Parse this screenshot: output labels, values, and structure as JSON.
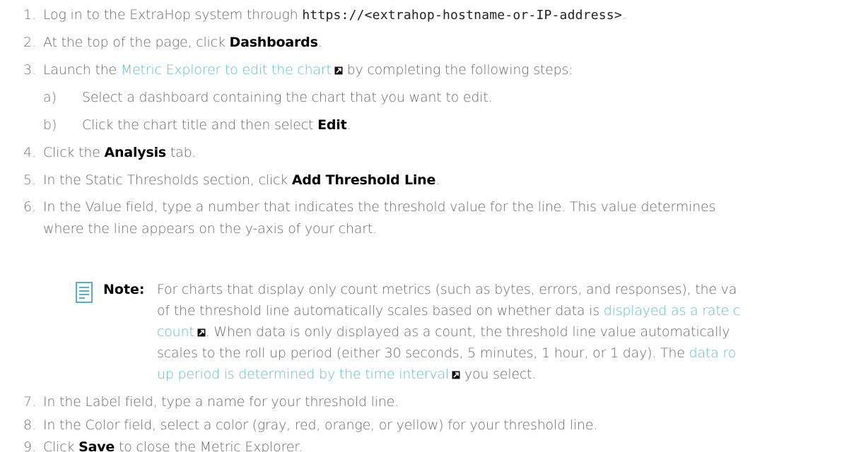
{
  "steps": [
    {
      "num": "1.",
      "text_a": "Log in to the ExtraHop system through ",
      "code": "https://<extrahop-hostname-or-IP-address>",
      "text_b": "."
    },
    {
      "num": "2.",
      "text_a": "At the top of the page, click ",
      "bold": "Dashboards",
      "text_b": "."
    },
    {
      "num": "3.",
      "text_a": "Launch the ",
      "link": "Metric Explorer to edit the chart",
      "text_b": " by completing the following steps:"
    },
    {
      "num": "4.",
      "text_a": "Click the ",
      "bold": "Analysis",
      "text_b": " tab."
    },
    {
      "num": "5.",
      "text_a": "In the Static Thresholds section, click ",
      "bold": "Add Threshold Line",
      "text_b": "."
    },
    {
      "num": "6.",
      "line1": "In the Value field, type a number that indicates the threshold value for the line. This value determines",
      "line2": "where the line appears on the y-axis of your chart."
    },
    {
      "num": "7.",
      "text": "In the Label field, type a name for your threshold line."
    },
    {
      "num": "8.",
      "text": "In the Color field, select a color (gray, red, orange, or yellow) for your threshold line."
    },
    {
      "num": "9.",
      "text_a": "Click ",
      "bold": "Save",
      "text_b": " to close the Metric Explorer."
    }
  ],
  "substeps": [
    {
      "label": "a)",
      "text": "Select a dashboard containing the chart that you want to edit."
    },
    {
      "label": "b)",
      "text_a": "Click the chart title and then select ",
      "bold": "Edit",
      "text_b": "."
    }
  ],
  "note": {
    "label": "Note:",
    "line1": "For charts that display only count metrics (such as bytes, errors, and responses), the va",
    "line2_a": "of the threshold line automatically scales based on whether data is ",
    "line2_link": "displayed as a rate c",
    "line3_link": "count",
    "line3_b": ". When data is only displayed as a count, the threshold line value automatically",
    "line4_a": "scales to the roll up period (either 30 seconds, 5 minutes, 1 hour, or 1 day). The ",
    "line4_link": "data ro",
    "line5_link": "up period is determined by the time interval",
    "line5_b": " you select."
  },
  "colors": {
    "text": "#6a6a6a",
    "bold": "#000000",
    "link": "#5cc1c1",
    "code": "#222222",
    "note_icon": "#4fb3c8"
  },
  "icons": [
    "external-link-icon",
    "note-icon"
  ]
}
